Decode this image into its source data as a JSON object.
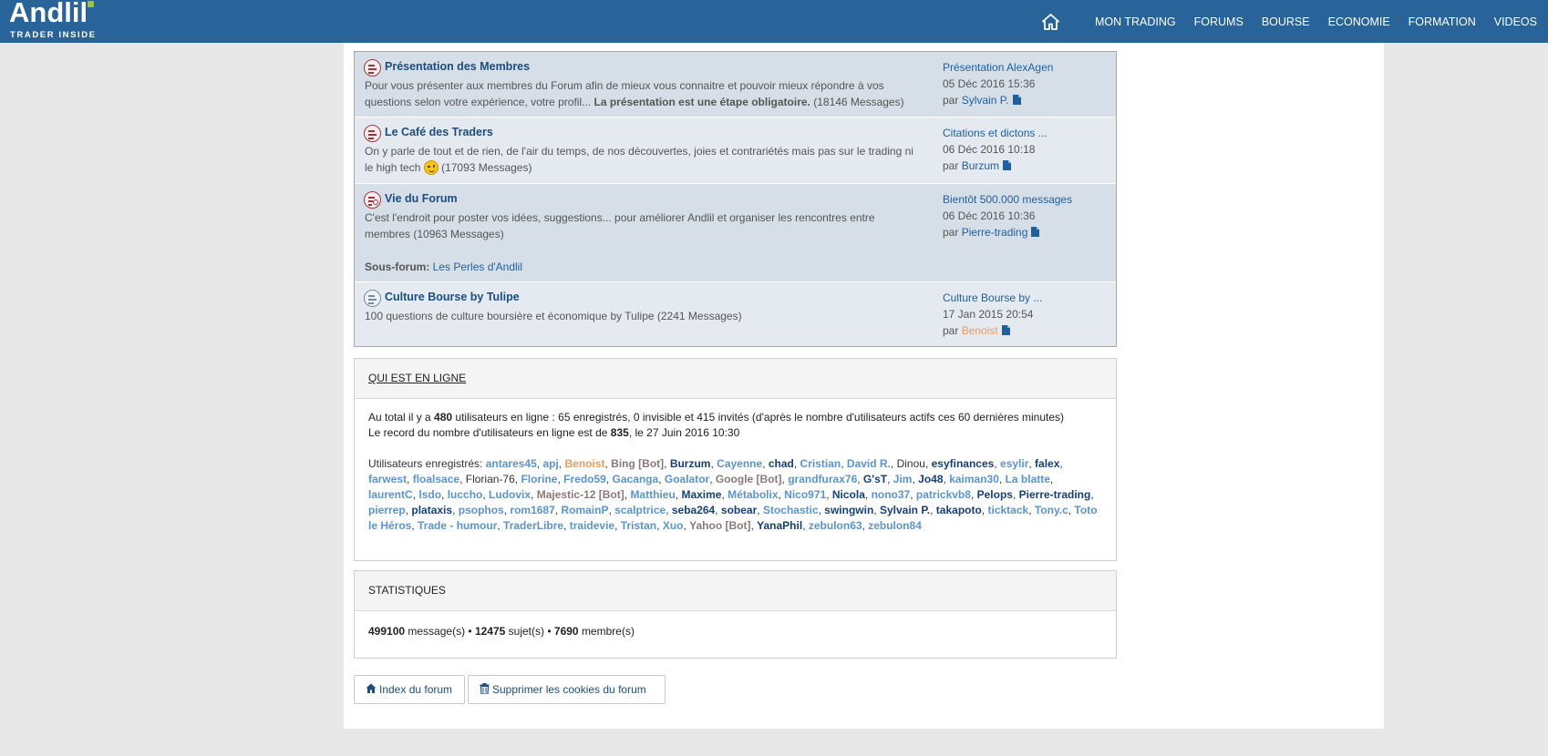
{
  "header": {
    "logo_name": "Andlil",
    "logo_tagline": "TRADER INSIDE",
    "nav": [
      "MON TRADING",
      "FORUMS",
      "BOURSE",
      "ECONOMIE",
      "FORMATION",
      "VIDEOS"
    ]
  },
  "forums": [
    {
      "title": "Présentation des Membres",
      "desc": "Pour vous présenter aux membres du Forum afin de mieux vous connaitre et pouvoir mieux répondre à vos questions selon votre expérience, votre profil...",
      "desc_bold": "La présentation est une étape obligatoire.",
      "count": "(18146 Messages)",
      "last_title": "Présentation AlexAgen",
      "last_date": "05 Déc 2016 15:36",
      "by": "par",
      "last_user": "Sylvain P."
    },
    {
      "title": "Le Café des Traders",
      "desc": "On y parle de tout et de rien, de l'air du temps, de nos découvertes, joies et contrariétés mais pas sur le trading ni le high tech",
      "count": "(17093 Messages)",
      "last_title": "Citations et dictons ...",
      "last_date": "06 Déc 2016 10:18",
      "by": "par",
      "last_user": "Burzum"
    },
    {
      "title": "Vie du Forum",
      "desc": "C'est l'endroit pour poster vos idées, suggestions... pour améliorer Andlil et organiser les rencontres entre membres (10963 Messages)",
      "subforum_label": "Sous-forum:",
      "subforum_link": "Les Perles d'Andlil",
      "last_title": "Bientôt 500.000 messages",
      "last_date": "06 Déc 2016 10:36",
      "by": "par",
      "last_user": "Pierre-trading"
    },
    {
      "title": "Culture Bourse by Tulipe",
      "desc": "100 questions de culture boursière et économique by Tulipe (2241 Messages)",
      "last_title": "Culture Bourse by ...",
      "last_date": "17 Jan 2015 20:54",
      "by": "par",
      "last_user": "Benoist"
    }
  ],
  "online": {
    "heading": "QUI EST EN LIGNE",
    "total_prefix": "Au total il y a",
    "total_count": "480",
    "total_suffix": "utilisateurs en ligne : 65 enregistrés, 0 invisible et 415 invités (d'après le nombre d'utilisateurs actifs ces 60 dernières minutes)",
    "record_prefix": "Le record du nombre d'utilisateurs en ligne est de",
    "record_count": "835",
    "record_suffix": ", le 27 Juin 2016 10:30",
    "registered_label": "Utilisateurs enregistrés:",
    "users": [
      {
        "name": "antares45",
        "style": "light"
      },
      {
        "name": "apj",
        "style": "light"
      },
      {
        "name": "Benoist",
        "style": "orange"
      },
      {
        "name": "Bing [Bot]",
        "style": "bot"
      },
      {
        "name": "Burzum",
        "style": "dark"
      },
      {
        "name": "Cayenne",
        "style": "light"
      },
      {
        "name": "chad",
        "style": "dark"
      },
      {
        "name": "Cristian",
        "style": "light"
      },
      {
        "name": "David R.",
        "style": "light"
      },
      {
        "name": "Dinou",
        "style": "plain"
      },
      {
        "name": "esyfinances",
        "style": "dark"
      },
      {
        "name": "esylir",
        "style": "light"
      },
      {
        "name": "falex",
        "style": "dark"
      },
      {
        "name": "farwest",
        "style": "light"
      },
      {
        "name": "floalsace",
        "style": "light"
      },
      {
        "name": "Florian-76",
        "style": "plain"
      },
      {
        "name": "Florine",
        "style": "light"
      },
      {
        "name": "Fredo59",
        "style": "light"
      },
      {
        "name": "Gacanga",
        "style": "light"
      },
      {
        "name": "Goalator",
        "style": "light"
      },
      {
        "name": "Google [Bot]",
        "style": "bot"
      },
      {
        "name": "grandfurax76",
        "style": "light"
      },
      {
        "name": "G'sT",
        "style": "dark"
      },
      {
        "name": "Jim",
        "style": "light"
      },
      {
        "name": "Jo48",
        "style": "dark"
      },
      {
        "name": "kaiman30",
        "style": "light"
      },
      {
        "name": "La blatte",
        "style": "light"
      },
      {
        "name": "laurentC",
        "style": "light"
      },
      {
        "name": "lsdo",
        "style": "light"
      },
      {
        "name": "luccho",
        "style": "light"
      },
      {
        "name": "Ludovix",
        "style": "light"
      },
      {
        "name": "Majestic-12 [Bot]",
        "style": "bot"
      },
      {
        "name": "Matthieu",
        "style": "light"
      },
      {
        "name": "Maxime",
        "style": "dark"
      },
      {
        "name": "Métabolix",
        "style": "light"
      },
      {
        "name": "Nico971",
        "style": "light"
      },
      {
        "name": "Nicola",
        "style": "dark"
      },
      {
        "name": "nono37",
        "style": "light"
      },
      {
        "name": "patrickvb8",
        "style": "light"
      },
      {
        "name": "Pelops",
        "style": "dark"
      },
      {
        "name": "Pierre-trading",
        "style": "dark"
      },
      {
        "name": "pierrep",
        "style": "light"
      },
      {
        "name": "plataxis",
        "style": "dark"
      },
      {
        "name": "psophos",
        "style": "light"
      },
      {
        "name": "rom1687",
        "style": "light"
      },
      {
        "name": "RomainP",
        "style": "light"
      },
      {
        "name": "scalptrice",
        "style": "light"
      },
      {
        "name": "seba264",
        "style": "dark"
      },
      {
        "name": "sobear",
        "style": "dark"
      },
      {
        "name": "Stochastic",
        "style": "light"
      },
      {
        "name": "swingwin",
        "style": "dark"
      },
      {
        "name": "Sylvain P.",
        "style": "dark"
      },
      {
        "name": "takapoto",
        "style": "dark"
      },
      {
        "name": "ticktack",
        "style": "light"
      },
      {
        "name": "Tony.c",
        "style": "light"
      },
      {
        "name": "Toto le Héros",
        "style": "light"
      },
      {
        "name": "Trade - humour",
        "style": "light"
      },
      {
        "name": "TraderLibre",
        "style": "light"
      },
      {
        "name": "traidevie",
        "style": "light"
      },
      {
        "name": "Tristan",
        "style": "light"
      },
      {
        "name": "Xuo",
        "style": "light"
      },
      {
        "name": "Yahoo [Bot]",
        "style": "bot"
      },
      {
        "name": "YanaPhil",
        "style": "dark"
      },
      {
        "name": "zebulon63",
        "style": "light"
      },
      {
        "name": "zebulon84",
        "style": "light"
      }
    ]
  },
  "stats": {
    "heading": "STATISTIQUES",
    "messages": "499100",
    "messages_label": "message(s) •",
    "topics": "12475",
    "topics_label": "sujet(s) •",
    "members": "7690",
    "members_label": "membre(s)"
  },
  "buttons": {
    "index": "Index du forum",
    "cookies": "Supprimer les cookies du forum"
  },
  "colors": {
    "header_bg": "#28639a",
    "logo_accent": "#9bc53d",
    "link": "#1f5f9c",
    "user_dark": "#16407a",
    "user_light": "#5a94d1",
    "user_orange": "#ee9a5f",
    "bot": "#8a7a7a"
  }
}
